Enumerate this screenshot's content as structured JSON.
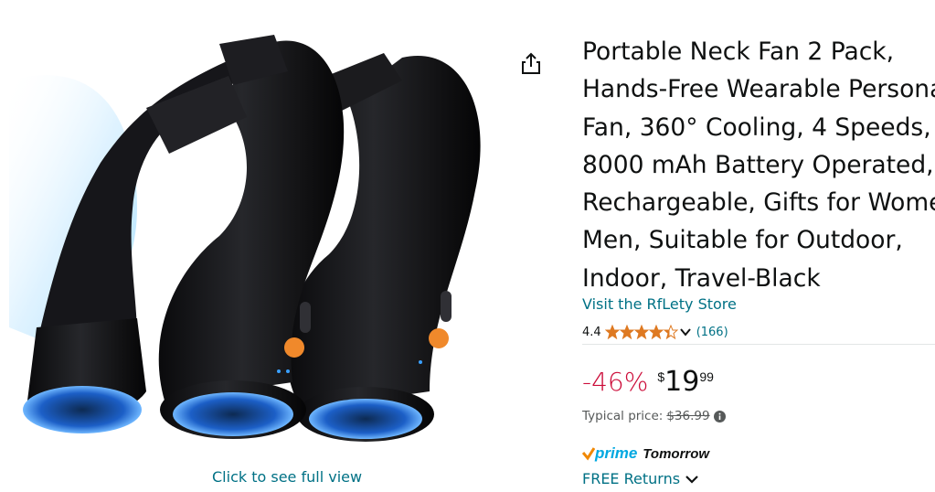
{
  "product": {
    "title_lines": [
      "Portable Neck Fan 2 Pack,",
      "Hands-Free Wearable Personal",
      "Fan, 360° Cooling, 4 Speeds,",
      "8000 mAh Battery Operated,",
      "Rechargeable, Gifts for Women",
      "Men, Suitable for Outdoor,",
      "Indoor, Travel-Black"
    ],
    "store_link": "Visit the RfLety Store",
    "rating_value": "4.4",
    "rating_stars": 4.4,
    "review_count": "(166)",
    "discount": "-46%",
    "price_symbol": "$",
    "price_whole": "19",
    "price_fraction": "99",
    "typical_label": "Typical price:",
    "typical_price": "$36.99",
    "prime_label": "prime",
    "delivery": "Tomorrow",
    "returns": "FREE Returns"
  },
  "gallery": {
    "full_view": "Click to see full view"
  },
  "colors": {
    "link": "#007185",
    "discount": "#cc0c39",
    "star": "#de7921",
    "prime": "#00a8e1",
    "text": "#0f1111"
  },
  "icons": [
    "share-icon",
    "star-icon",
    "chevron-down-icon",
    "info-icon",
    "prime-check-icon"
  ]
}
